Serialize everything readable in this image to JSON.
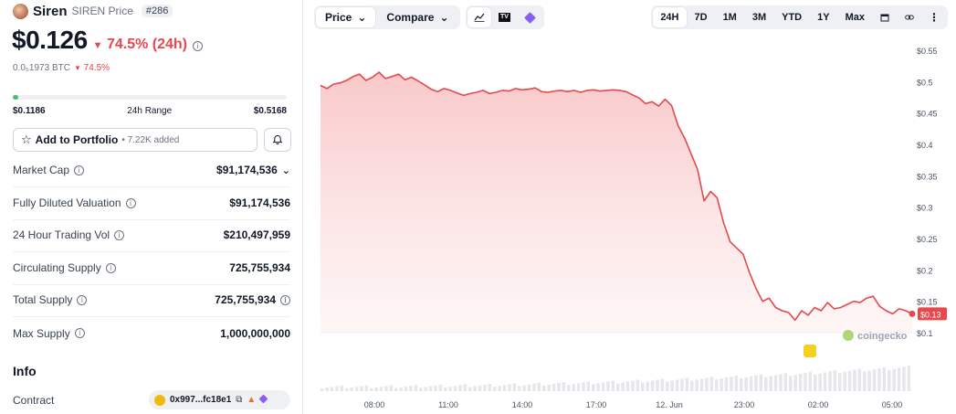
{
  "coin": {
    "name": "Siren",
    "subtitle": "SIREN Price",
    "rank": "#286",
    "price": "$0.126",
    "change_24h": "74.5% (24h)",
    "btc_price": "0.0₅1973 BTC",
    "btc_change": "74.5%",
    "colors": {
      "down": "#e5484d",
      "range_fill": "#4bbf6b"
    }
  },
  "range": {
    "low": "$0.1186",
    "label": "24h Range",
    "high": "$0.5168",
    "current_fraction": 0.02
  },
  "portfolio": {
    "label": "Add to Portfolio",
    "added": "• 7.22K added"
  },
  "stats": [
    {
      "label": "Market Cap",
      "value": "$91,174,536"
    },
    {
      "label": "Fully Diluted Valuation",
      "value": "$91,174,536"
    },
    {
      "label": "24 Hour Trading Vol",
      "value": "$210,497,959"
    },
    {
      "label": "Circulating Supply",
      "value": "725,755,934"
    },
    {
      "label": "Total Supply",
      "value": "725,755,934"
    },
    {
      "label": "Max Supply",
      "value": "1,000,000,000"
    }
  ],
  "info": {
    "title": "Info",
    "contract_label": "Contract",
    "contract_address": "0x997...fc18e1"
  },
  "toolbar": {
    "price_tab": "Price",
    "compare_tab": "Compare",
    "tv_label": "TV",
    "periods": [
      "24H",
      "7D",
      "1M",
      "3M",
      "YTD",
      "1Y",
      "Max"
    ],
    "active_period": "24H"
  },
  "chart_data": {
    "type": "area",
    "y_ticks": [
      "$0.55",
      "$0.5",
      "$0.45",
      "$0.4",
      "$0.35",
      "$0.3",
      "$0.25",
      "$0.2",
      "$0.15",
      "$0.1"
    ],
    "ylim": [
      0.1,
      0.55
    ],
    "x_ticks": [
      "08:00",
      "11:00",
      "14:00",
      "17:00",
      "12. Jun",
      "23:00",
      "02:00",
      "05:00"
    ],
    "current_label": "$0.13",
    "watermark": "coingecko",
    "line_color": "#e5484d",
    "series": [
      {
        "values": [
          0.494,
          0.489,
          0.496,
          0.498,
          0.502,
          0.508,
          0.512,
          0.502,
          0.507,
          0.515,
          0.505,
          0.508,
          0.512,
          0.503,
          0.507,
          0.501,
          0.495,
          0.488,
          0.484,
          0.489,
          0.486,
          0.482,
          0.478,
          0.481,
          0.483,
          0.486,
          0.481,
          0.483,
          0.486,
          0.485,
          0.489,
          0.487,
          0.488,
          0.49,
          0.484,
          0.483,
          0.485,
          0.486,
          0.484,
          0.486,
          0.483,
          0.486,
          0.487,
          0.485,
          0.486,
          0.487,
          0.486,
          0.484,
          0.479,
          0.474,
          0.465,
          0.468,
          0.461,
          0.472,
          0.462,
          0.43,
          0.41,
          0.385,
          0.36,
          0.31,
          0.325,
          0.315,
          0.275,
          0.245,
          0.235,
          0.225,
          0.195,
          0.17,
          0.15,
          0.155,
          0.14,
          0.135,
          0.132,
          0.12,
          0.135,
          0.128,
          0.14,
          0.135,
          0.148,
          0.138,
          0.14,
          0.145,
          0.15,
          0.148,
          0.155,
          0.158,
          0.142,
          0.135,
          0.13,
          0.138,
          0.135,
          0.13
        ]
      }
    ]
  }
}
